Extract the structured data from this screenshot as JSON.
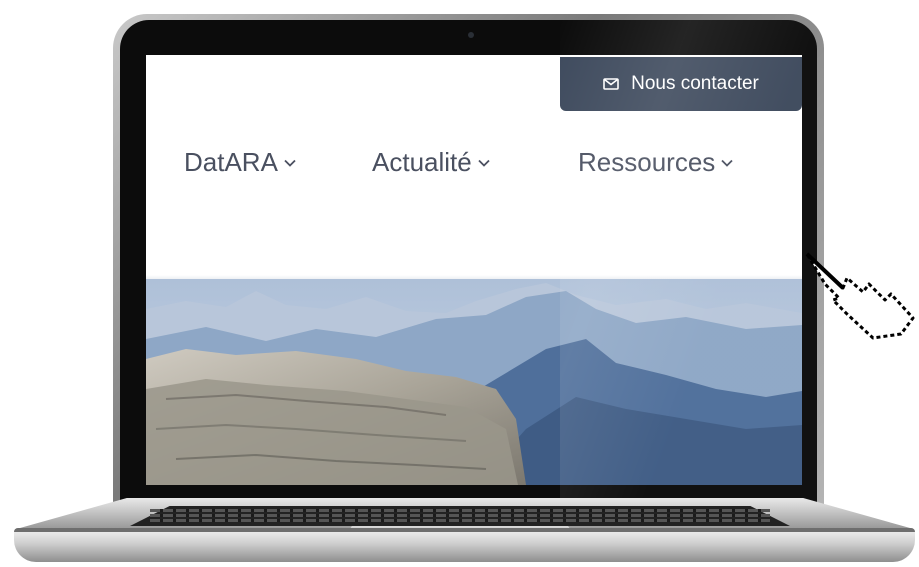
{
  "contact": {
    "label": "Nous contacter",
    "icon": "mail-icon"
  },
  "nav": {
    "items": [
      {
        "label": "DatARA"
      },
      {
        "label": "Actualité"
      },
      {
        "label": "Ressources"
      }
    ]
  },
  "hero": {
    "icon": "mountain-photo"
  },
  "cursor": {
    "icon": "hand-pointer-icon"
  },
  "colors": {
    "contact_bg": "#3e4a5d",
    "nav_text": "#4a5060",
    "sky": "#9fb6d3"
  }
}
